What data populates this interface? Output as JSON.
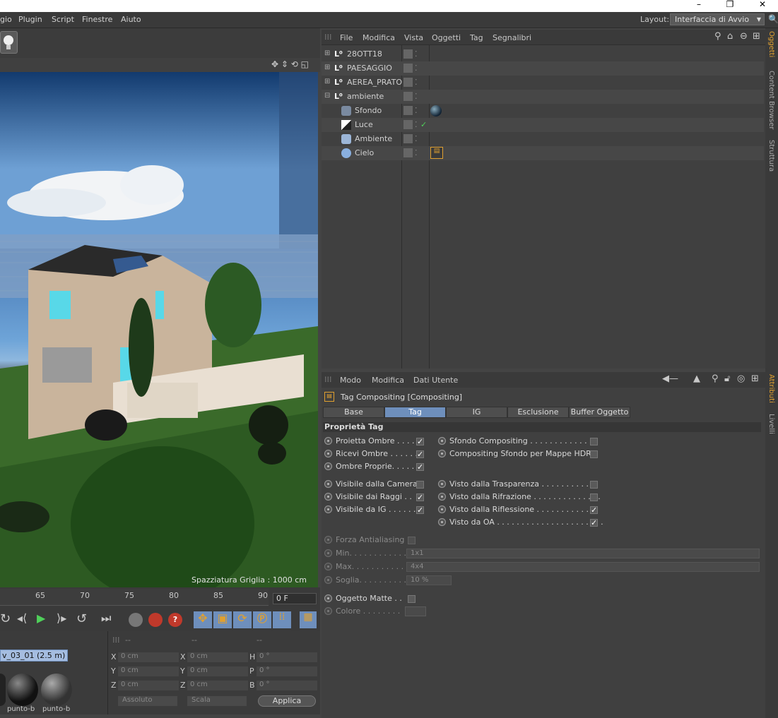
{
  "window": {
    "minimize": "–",
    "restore": "❐",
    "close": "✕"
  },
  "menubar": {
    "items": [
      "gio",
      "Plugin",
      "Script",
      "Finestre",
      "Aiuto"
    ],
    "layout_label": "Layout:",
    "layout_value": "Interfaccia di Avvio"
  },
  "viewport": {
    "grid_spacing": "Spazziatura Griglia : 1000 cm"
  },
  "timeline": {
    "ticks": [
      "65",
      "70",
      "75",
      "80",
      "85",
      "90"
    ],
    "frame": "0 F"
  },
  "material": {
    "name": "v_03_01 (2.5 m)",
    "labels": [
      "punto-b",
      "punto-b"
    ]
  },
  "coords": {
    "rows": [
      [
        "X",
        "0 cm",
        "X",
        "0 cm",
        "H",
        "0 °"
      ],
      [
        "Y",
        "0 cm",
        "Y",
        "0 cm",
        "P",
        "0 °"
      ],
      [
        "Z",
        "0 cm",
        "Z",
        "0 cm",
        "B",
        "0 °"
      ]
    ],
    "header": [
      "--",
      "--",
      "--"
    ],
    "mode": "Assoluto",
    "scale": "Scala",
    "apply": "Applica"
  },
  "object_manager": {
    "menu": [
      "File",
      "Modifica",
      "Vista",
      "Oggetti",
      "Tag",
      "Segnalibri"
    ],
    "objects": [
      {
        "name": "28OTT18"
      },
      {
        "name": "PAESAGGIO"
      },
      {
        "name": "AEREA_PRATO"
      },
      {
        "name": "ambiente"
      },
      {
        "name": "Sfondo"
      },
      {
        "name": "Luce"
      },
      {
        "name": "Ambiente"
      },
      {
        "name": "Cielo"
      }
    ]
  },
  "attribute_manager": {
    "menu": [
      "Modo",
      "Modifica",
      "Dati Utente"
    ],
    "title": "Tag Compositing [Compositing]",
    "tabs": [
      "Base",
      "Tag",
      "IG",
      "Esclusione",
      "Buffer Oggetto"
    ],
    "active_tab": "Tag",
    "section": "Proprietà Tag",
    "left_opts": [
      {
        "label": "Proietta Ombre . . . .",
        "checked": true
      },
      {
        "label": "Ricevi Ombre . . . . . .",
        "checked": true
      },
      {
        "label": "Ombre Proprie. . . . .",
        "checked": true
      },
      {
        "label": "Visibile dalla Camera",
        "checked": false
      },
      {
        "label": "Visibile dai Raggi . .",
        "checked": true
      },
      {
        "label": "Visibile da IG . . . . . .",
        "checked": true
      }
    ],
    "right_opts": [
      {
        "label": "Sfondo Compositing . . . . . . . . . . . .",
        "checked": false
      },
      {
        "label": "Compositing Sfondo per Mappe HDR",
        "checked": false
      },
      {
        "label": "Visto dalla Trasparenza . . . . . . . . . . . .",
        "checked": false
      },
      {
        "label": "Visto dalla Rifrazione . . . . . . . . . . . . . .",
        "checked": false
      },
      {
        "label": "Visto dalla Riflessione . . . . . . . . . . . . .",
        "checked": true
      },
      {
        "label": "Visto da OA . . . . . . . . . . . . . . . . . . . . . .",
        "checked": true
      }
    ],
    "aa": {
      "force": "Forza Antialiasing",
      "min_label": "Min. . . . . . . . . . . .",
      "min": "1x1",
      "max_label": "Max. . . . . . . . . . . .",
      "max": "4x4",
      "thr_label": "Soglia. . . . . . . . . .",
      "thr": "10 %"
    },
    "matte": "Oggetto Matte . .",
    "color": "Colore . . . . . . . ."
  },
  "side_tabs": {
    "top": [
      "Oggetti",
      "Content Browser",
      "Struttura"
    ],
    "bottom": [
      "Attributi",
      "Livelli"
    ]
  },
  "colors": {
    "accent": "#6e8fbc",
    "orange": "#e0a030"
  }
}
